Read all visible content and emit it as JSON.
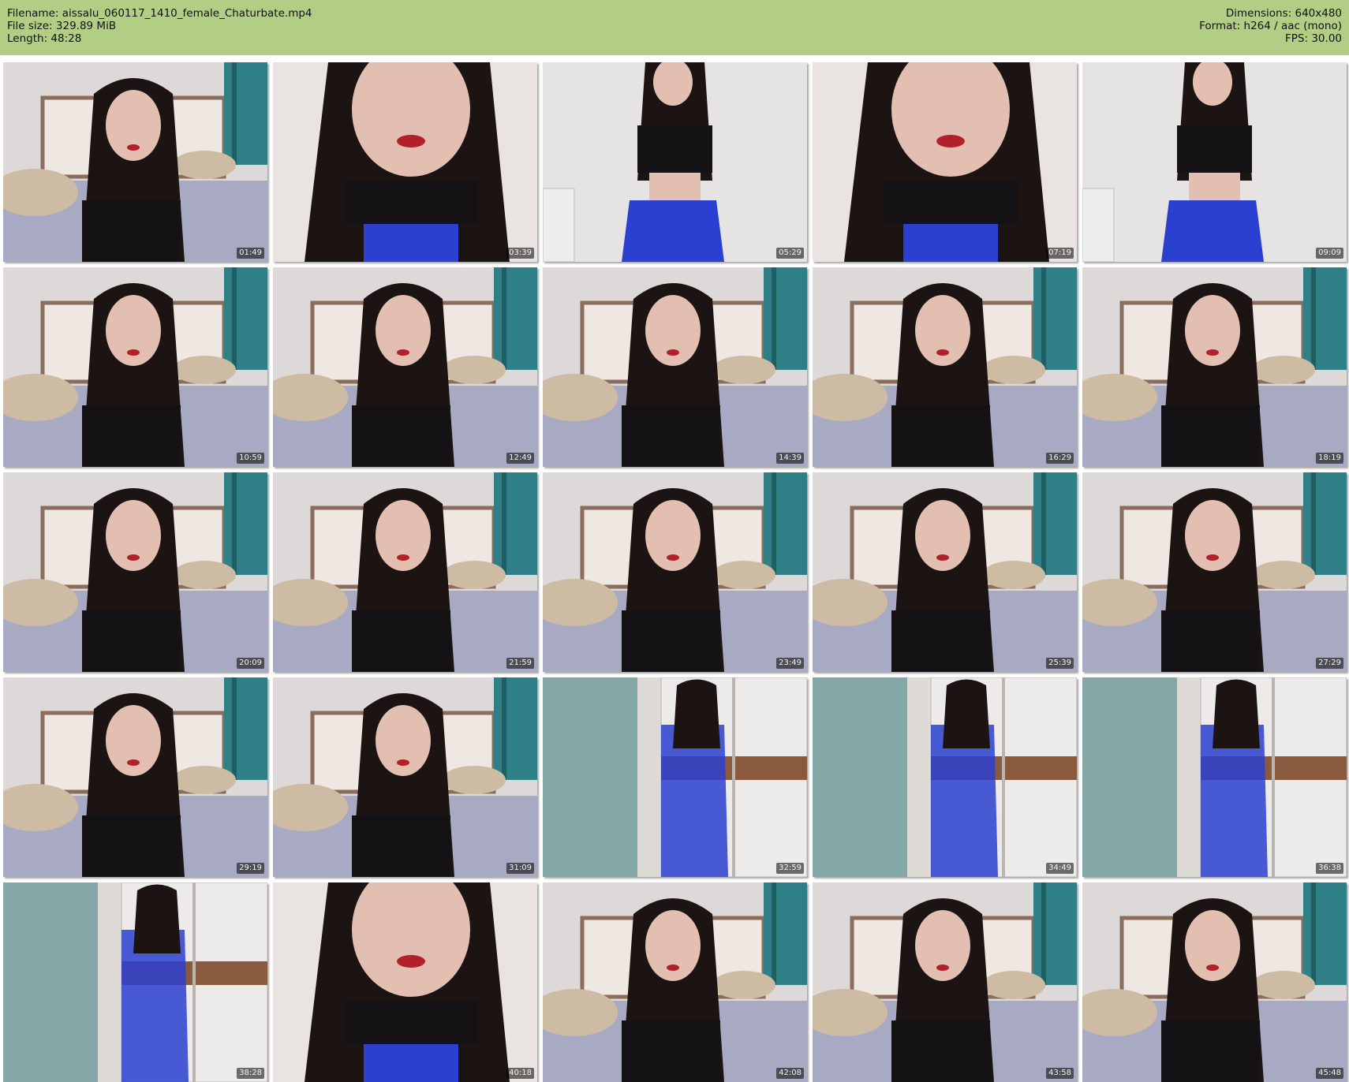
{
  "header": {
    "filename": "Filename: aissalu_060117_1410_female_Chaturbate.mp4",
    "filesize": "File size: 329.89 MiB",
    "length": "Length: 48:28",
    "dimensions": "Dimensions: 640x480",
    "format": "Format: h264 / aac (mono)",
    "fps": "FPS: 30.00"
  },
  "thumbnails": [
    {
      "time": "01:49",
      "scene": "bedroom"
    },
    {
      "time": "03:39",
      "scene": "closeup"
    },
    {
      "time": "05:29",
      "scene": "wall-standing"
    },
    {
      "time": "07:19",
      "scene": "closeup"
    },
    {
      "time": "09:09",
      "scene": "wall-standing"
    },
    {
      "time": "10:59",
      "scene": "bedroom"
    },
    {
      "time": "12:49",
      "scene": "bedroom"
    },
    {
      "time": "14:39",
      "scene": "bedroom"
    },
    {
      "time": "16:29",
      "scene": "bedroom"
    },
    {
      "time": "18:19",
      "scene": "bedroom"
    },
    {
      "time": "20:09",
      "scene": "bedroom"
    },
    {
      "time": "21:59",
      "scene": "bedroom"
    },
    {
      "time": "23:49",
      "scene": "bedroom"
    },
    {
      "time": "25:39",
      "scene": "bedroom"
    },
    {
      "time": "27:29",
      "scene": "bedroom"
    },
    {
      "time": "29:19",
      "scene": "bedroom"
    },
    {
      "time": "31:09",
      "scene": "bedroom"
    },
    {
      "time": "32:59",
      "scene": "wardrobe"
    },
    {
      "time": "34:49",
      "scene": "wardrobe"
    },
    {
      "time": "36:38",
      "scene": "wardrobe"
    },
    {
      "time": "38:28",
      "scene": "wardrobe"
    },
    {
      "time": "40:18",
      "scene": "closeup"
    },
    {
      "time": "42:08",
      "scene": "bedroom"
    },
    {
      "time": "43:58",
      "scene": "bedroom"
    },
    {
      "time": "45:48",
      "scene": "bedroom"
    }
  ],
  "colors": {
    "header_bg": "#b2cd84",
    "wall": "#dcd9d8",
    "bedspread": "#a8a9c2",
    "curtain": "#2f7f86",
    "hair": "#1b1412",
    "skin": "#e2bfb0",
    "top_black": "#141214",
    "pants_blue": "#2b3fd0",
    "wardrobe_white": "#ecebea",
    "wardrobe_wood": "#8a5a3e"
  }
}
